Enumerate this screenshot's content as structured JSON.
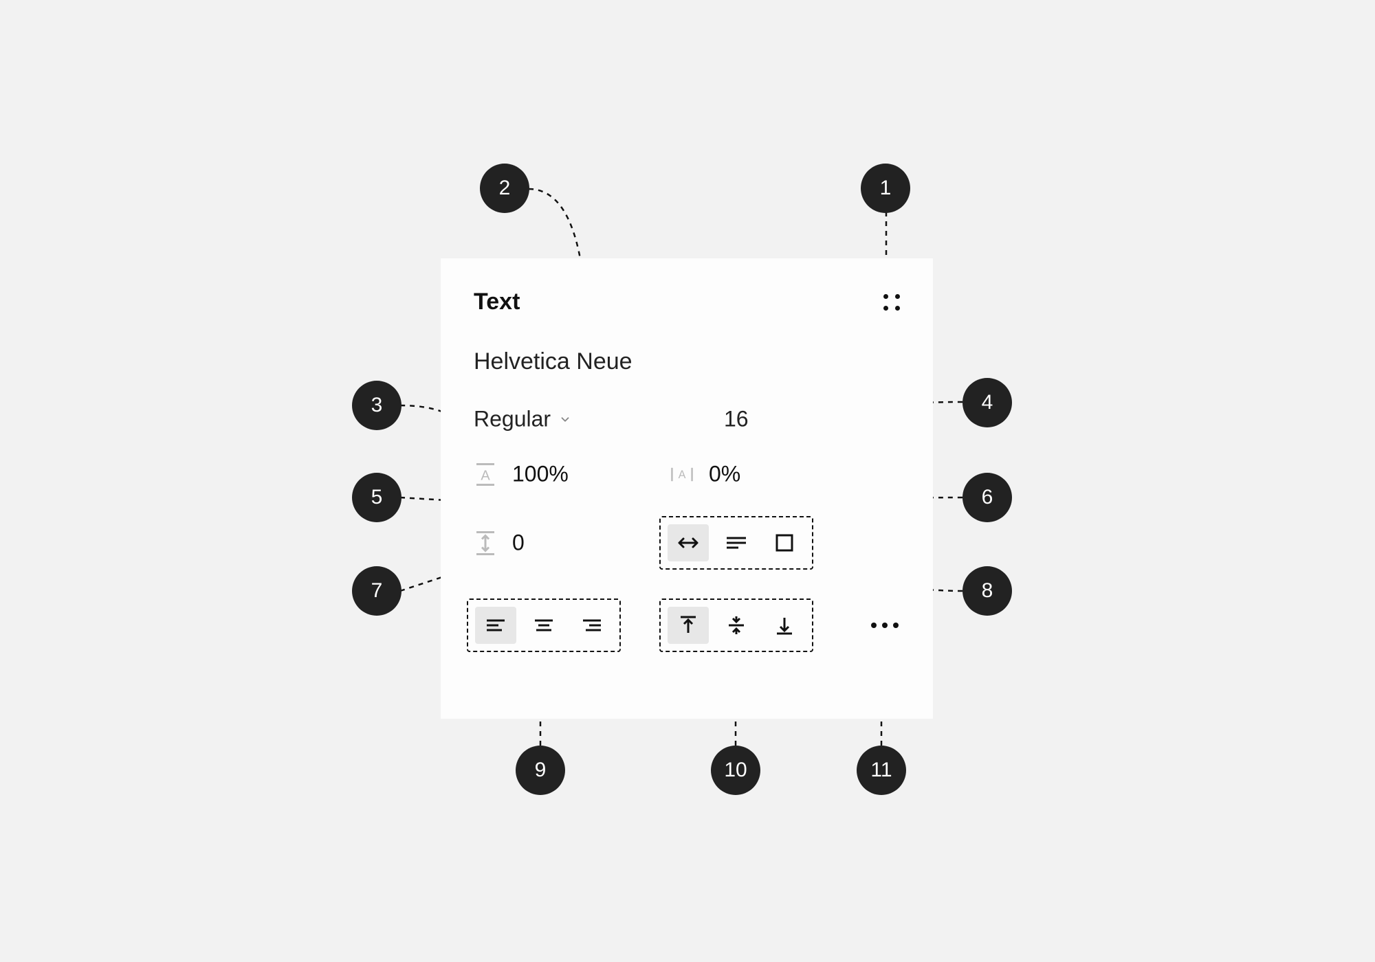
{
  "panel": {
    "title": "Text",
    "font_family": "Helvetica Neue",
    "font_weight": "Regular",
    "font_size": "16",
    "line_height": "100%",
    "letter_spacing": "0%",
    "paragraph_spacing": "0"
  },
  "callouts": {
    "1": "1",
    "2": "2",
    "3": "3",
    "4": "4",
    "5": "5",
    "6": "6",
    "7": "7",
    "8": "8",
    "9": "9",
    "10": "10",
    "11": "11"
  }
}
